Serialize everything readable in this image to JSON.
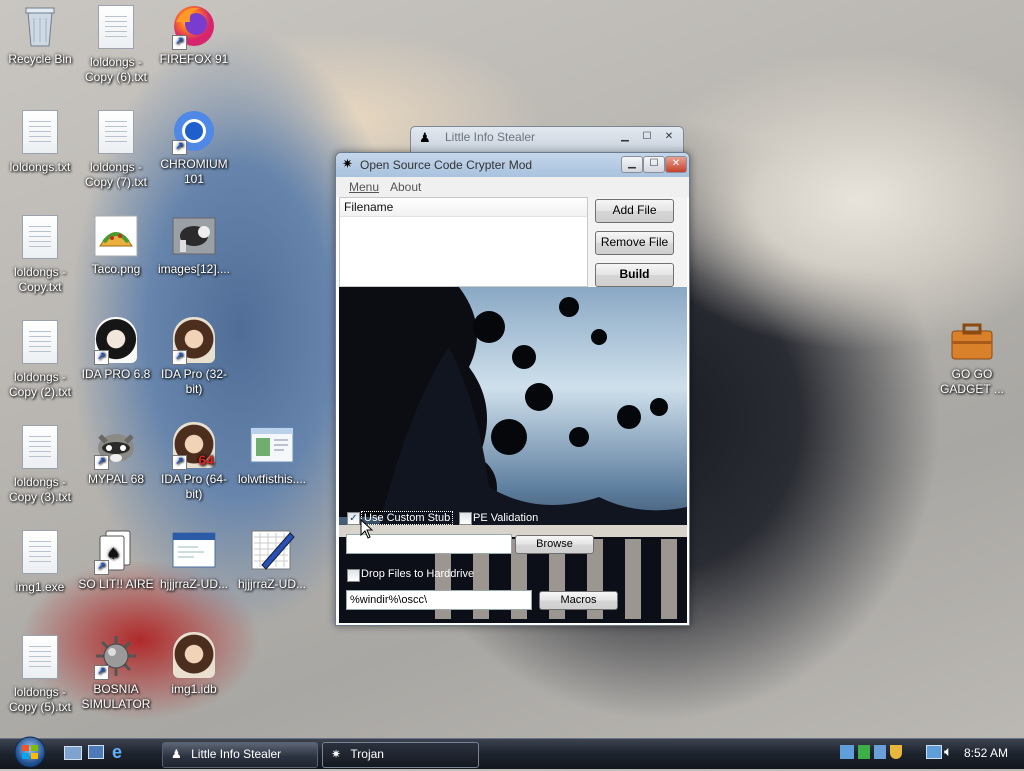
{
  "desktop": {
    "icons": [
      {
        "id": "recycle",
        "label": "Recycle Bin",
        "icon": "recycle-bin-icon"
      },
      {
        "id": "ld6",
        "label": "loldongs - Copy (6).txt",
        "icon": "text-file-icon"
      },
      {
        "id": "firefox",
        "label": "FIREFOX 91",
        "icon": "firefox-icon"
      },
      {
        "id": "ld",
        "label": "loldongs.txt",
        "icon": "text-file-icon"
      },
      {
        "id": "ld7",
        "label": "loldongs - Copy (7).txt",
        "icon": "text-file-icon"
      },
      {
        "id": "chromium",
        "label": "CHROMIUM 101",
        "icon": "chromium-icon"
      },
      {
        "id": "ldc",
        "label": "loldongs - Copy.txt",
        "icon": "text-file-icon"
      },
      {
        "id": "taco",
        "label": "Taco.png",
        "icon": "taco-image-icon"
      },
      {
        "id": "images12",
        "label": "images[12]....",
        "icon": "image-file-icon"
      },
      {
        "id": "ld2",
        "label": "loldongs - Copy (2).txt",
        "icon": "text-file-icon"
      },
      {
        "id": "ida68",
        "label": "IDA PRO 6.8",
        "icon": "ida-portrait-icon"
      },
      {
        "id": "ida32",
        "label": "IDA Pro (32-bit)",
        "icon": "ida-portrait-icon"
      },
      {
        "id": "ld3",
        "label": "loldongs - Copy (3).txt",
        "icon": "text-file-icon"
      },
      {
        "id": "mypal",
        "label": "MYPAL 68",
        "icon": "raccoon-icon"
      },
      {
        "id": "ida64",
        "label": "IDA Pro (64-bit)",
        "icon": "ida-portrait-icon"
      },
      {
        "id": "lolwtf",
        "label": "lolwtfisthis....",
        "icon": "window-file-icon"
      },
      {
        "id": "ld4",
        "label": "loldongs - Copy (4).txt",
        "icon": "text-file-icon"
      },
      {
        "id": "solitaire",
        "label": "SO LIT!! AIRE",
        "icon": "cards-icon"
      },
      {
        "id": "img1exe",
        "label": "img1.exe",
        "icon": "exe-window-icon"
      },
      {
        "id": "hjjj",
        "label": "hjjjrraZ-UD...",
        "icon": "pen-tablet-icon"
      },
      {
        "id": "ld5",
        "label": "loldongs - Copy (5).txt",
        "icon": "text-file-icon"
      },
      {
        "id": "bosnia",
        "label": "BOSNIA SIMULATOR",
        "icon": "spiked-mine-icon"
      },
      {
        "id": "img1idb",
        "label": "img1.idb",
        "icon": "ida-portrait-icon"
      },
      {
        "id": "gogo",
        "label": "GO GO GADGET ...",
        "icon": "briefcase-icon"
      }
    ]
  },
  "back_window": {
    "title": "Little Info Stealer"
  },
  "crypter": {
    "title": "Open Source Code Crypter Mod",
    "menu": [
      "Menu",
      "About"
    ],
    "list_header": "Filename",
    "buttons": {
      "add": "Add File",
      "remove": "Remove File",
      "build": "Build"
    },
    "use_custom_stub": {
      "label": "Use Custom Stub",
      "checked": true
    },
    "pe_validation": {
      "label": "PE Validation",
      "checked": false
    },
    "stub_path": {
      "value": ""
    },
    "browse": "Browse",
    "drop_files": {
      "label": "Drop Files to Harddrive",
      "checked": false
    },
    "drop_path": {
      "value": "%windir%\\oscc\\"
    },
    "macros": "Macros"
  },
  "taskbar": {
    "start": "start-orb-icon",
    "tasks": [
      {
        "label": "Little Info Stealer",
        "icon": "spy-icon"
      },
      {
        "label": "Trojan",
        "icon": "maple-leaf-icon",
        "active": true
      }
    ],
    "clock": "8:52 AM"
  },
  "colors": {
    "taskbar": "#1d232d",
    "title_active": "#b9d1ea"
  }
}
